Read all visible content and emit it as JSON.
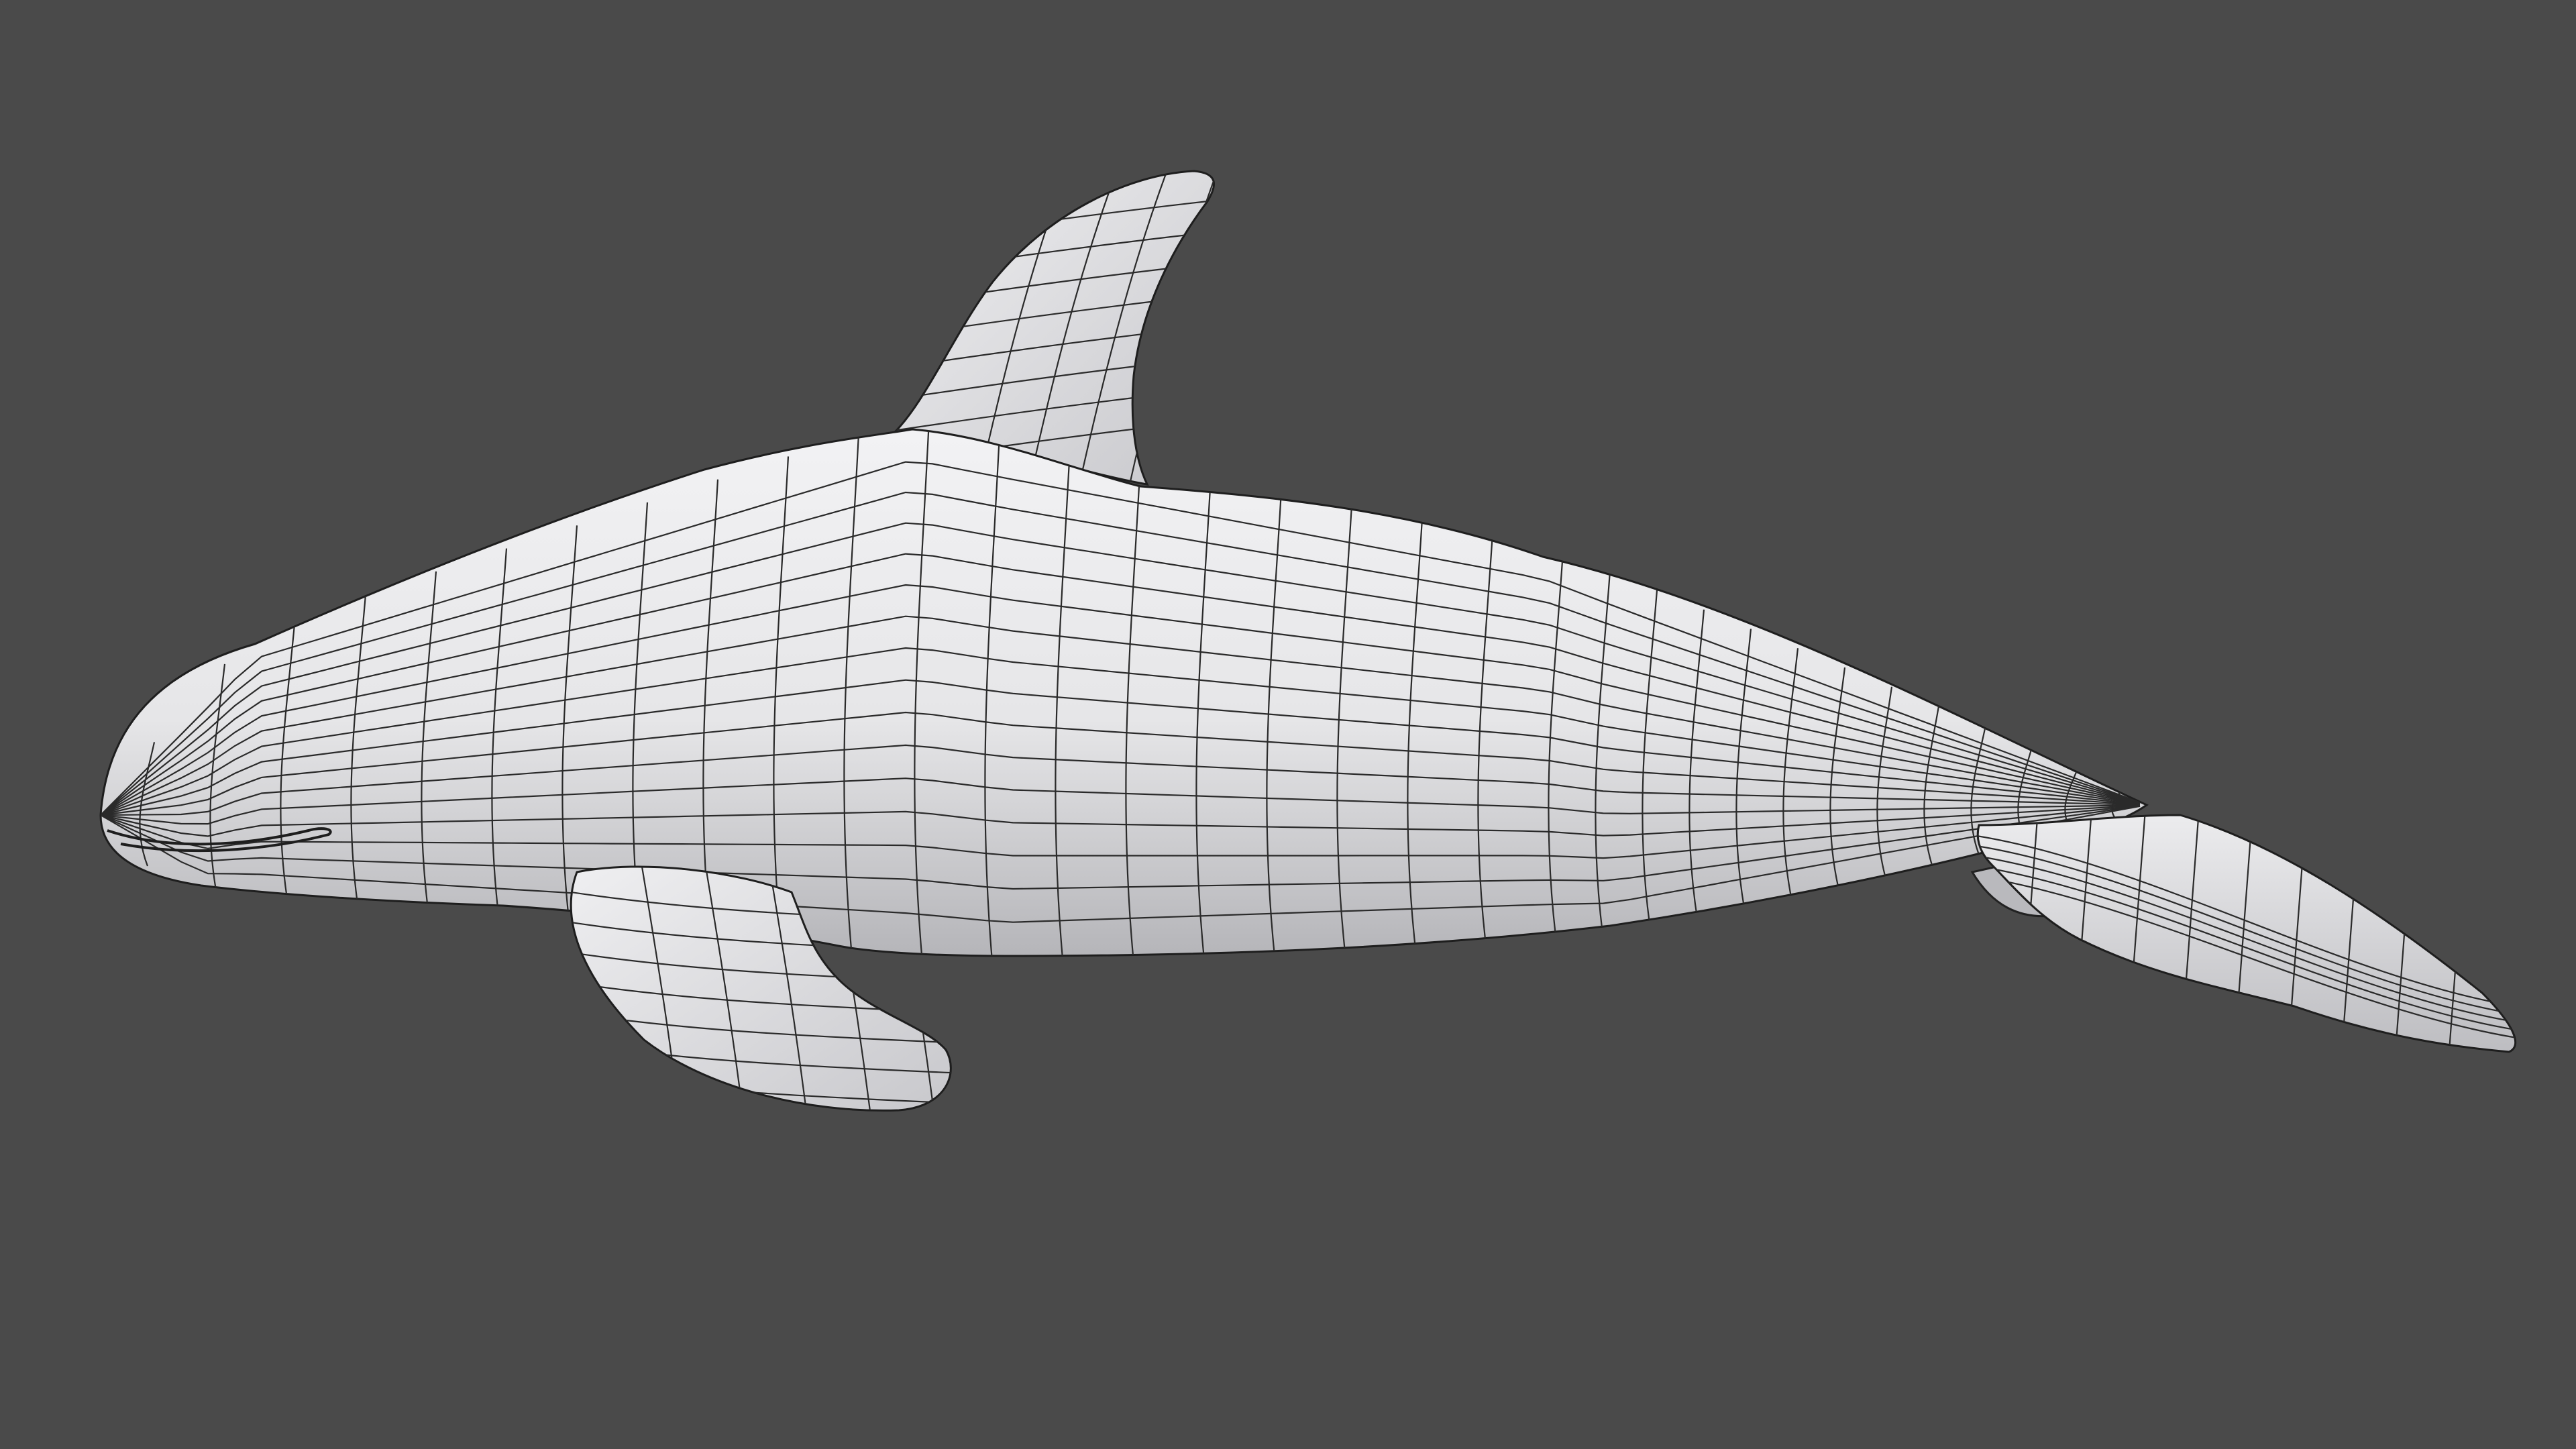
{
  "viewport": {
    "background_color": "#4a4a4a"
  },
  "model": {
    "object_name": "orca-model",
    "display_mode": "wireframe-over-solid",
    "surface_color": "#e9e9eb",
    "shadow_color": "#a9a9ad",
    "wire_color": "#2a2a2a",
    "outline_color": "#1e1e1e",
    "parts": [
      "body",
      "dorsal-fin",
      "pectoral-fin",
      "pelvic-fin",
      "tail-fluke",
      "mouth-line"
    ]
  }
}
